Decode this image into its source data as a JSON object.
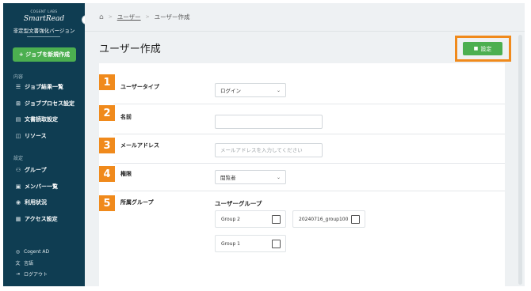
{
  "sidebar": {
    "brand_top": "COGENT LABS",
    "brand_name": "SmartRead",
    "brand_sub": "非定型文書強化バージョン",
    "collapse_glyph": "‹",
    "new_job_label": "+ ジョブを新規作成",
    "section_content": "内容",
    "section_settings": "設定",
    "items": [
      {
        "icon": "list-icon",
        "glyph": "☰",
        "label": "ジョブ結果一覧"
      },
      {
        "icon": "process-icon",
        "glyph": "⊞",
        "label": "ジョブプロセス設定"
      },
      {
        "icon": "document-icon",
        "glyph": "▤",
        "label": "文書読取設定"
      },
      {
        "icon": "resource-icon",
        "glyph": "◫",
        "label": "リソース"
      },
      {
        "icon": "group-icon",
        "glyph": "⚇",
        "label": "グループ"
      },
      {
        "icon": "members-icon",
        "glyph": "▣",
        "label": "メンバー一覧"
      },
      {
        "icon": "usage-icon",
        "glyph": "◉",
        "label": "利用状況"
      },
      {
        "icon": "access-icon",
        "glyph": "▦",
        "label": "アクセス設定"
      }
    ],
    "footer": [
      {
        "icon": "user-icon",
        "glyph": "◎",
        "label": "Cogent AD"
      },
      {
        "icon": "language-icon",
        "glyph": "文",
        "label": "言語"
      },
      {
        "icon": "logout-icon",
        "glyph": "⇥",
        "label": "ログアウト"
      }
    ]
  },
  "header": {
    "home_glyph": "⌂",
    "sep": ">",
    "breadcrumb_link": "ユーザー",
    "breadcrumb_current": "ユーザー作成"
  },
  "page": {
    "title": "ユーザー作成",
    "save_label": "設定",
    "save_glyph": "■"
  },
  "form": {
    "steps": [
      "1",
      "2",
      "3",
      "4",
      "5"
    ],
    "user_type_label": "ユーザータイプ",
    "user_type_value": "ログイン",
    "name_label": "名前",
    "name_value": "",
    "email_label": "メールアドレス",
    "email_placeholder": "メールアドレスを入力してください",
    "role_label": "権限",
    "role_value": "閲覧者",
    "group_label": "所属グループ",
    "user_group_title": "ユーザーグループ",
    "chevron": "⌄",
    "groups": [
      {
        "name": "Group 2",
        "checked": false
      },
      {
        "name": "20240716_group100",
        "checked": false
      },
      {
        "name": "Group 1",
        "checked": false
      }
    ]
  },
  "colors": {
    "sidebar_bg": "#0f3d52",
    "accent_green": "#4caf50",
    "highlight_orange": "#f08a1c"
  }
}
